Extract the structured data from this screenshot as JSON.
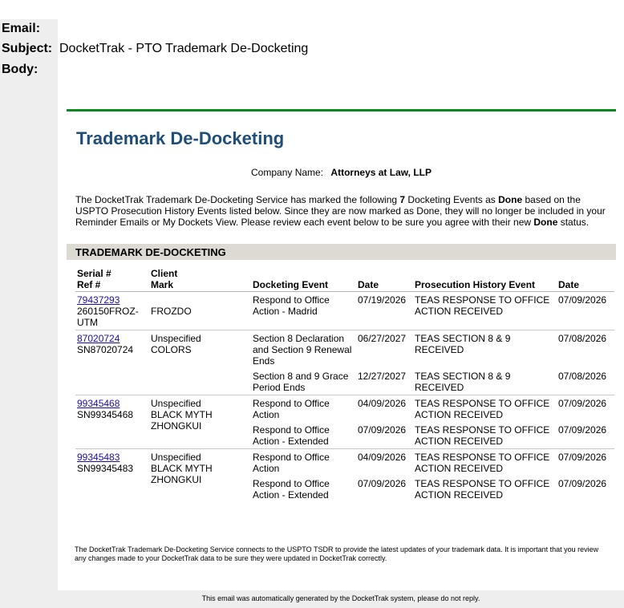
{
  "headers": {
    "email_label": "Email:",
    "subject_label": "Subject:",
    "subject_value": "DocketTrak - PTO Trademark De-Docketing",
    "body_label": "Body:"
  },
  "content": {
    "title": "Trademark De-Docketing",
    "company_label": "Company Name:",
    "company_value": "Attorneys at Law, LLP",
    "intro_part1": "The DocketTrak Trademark De-Docketing Service has marked the following ",
    "intro_count": "7",
    "intro_part2": " Docketing Events as ",
    "intro_done1": "Done",
    "intro_part3": " based on the USPTO Prosecution History Events listed below. Since they are now marked as Done, they will no longer be included in your Reminder Emails or My Dockets View. Please review each event below to be sure you agree with their new ",
    "intro_done2": "Done",
    "intro_part4": " status.",
    "section_title": "TRADEMARK DE-DOCKETING"
  },
  "table": {
    "headers": {
      "serial": "Serial #",
      "ref": "Ref #",
      "client": "Client",
      "mark": "Mark",
      "event": "Docketing Event",
      "date": "Date",
      "phe": "Prosecution History Event",
      "date2": "Date"
    },
    "groups": [
      {
        "serial": "79437293",
        "ref": "260150FROZ-UTM",
        "client": "",
        "mark": "FROZDO",
        "events": [
          {
            "event": "Respond to Office Action - Madrid",
            "date": "07/19/2026",
            "phe": "TEAS RESPONSE TO OFFICE ACTION RECEIVED",
            "phe_date": "07/09/2026"
          }
        ]
      },
      {
        "serial": "87020724",
        "ref": "SN87020724",
        "client": "Unspecified",
        "mark": "COLORS",
        "events": [
          {
            "event": "Section 8 Declaration and Section 9 Renewal Ends",
            "date": "06/27/2027",
            "phe": "TEAS SECTION 8 & 9 RECEIVED",
            "phe_date": "07/08/2026"
          },
          {
            "event": "Section 8 and 9 Grace Period Ends",
            "date": "12/27/2027",
            "phe": "TEAS SECTION 8 & 9 RECEIVED",
            "phe_date": "07/08/2026"
          }
        ]
      },
      {
        "serial": "99345468",
        "ref": "SN99345468",
        "client": "Unspecified",
        "mark": "BLACK MYTH ZHONGKUI",
        "events": [
          {
            "event": "Respond to Office Action",
            "date": "04/09/2026",
            "phe": "TEAS RESPONSE TO OFFICE ACTION RECEIVED",
            "phe_date": "07/09/2026"
          },
          {
            "event": "Respond to Office Action - Extended",
            "date": "07/09/2026",
            "phe": "TEAS RESPONSE TO OFFICE ACTION RECEIVED",
            "phe_date": "07/09/2026"
          }
        ]
      },
      {
        "serial": "99345483",
        "ref": "SN99345483",
        "client": "Unspecified",
        "mark": "BLACK MYTH ZHONGKUI",
        "events": [
          {
            "event": "Respond to Office Action",
            "date": "04/09/2026",
            "phe": "TEAS RESPONSE TO OFFICE ACTION RECEIVED",
            "phe_date": "07/09/2026"
          },
          {
            "event": "Respond to Office Action - Extended",
            "date": "07/09/2026",
            "phe": "TEAS RESPONSE TO OFFICE ACTION RECEIVED",
            "phe_date": "07/09/2026"
          }
        ]
      }
    ]
  },
  "footer": {
    "note": "The DocketTrak Trademark De-Docketing Service connects to the USPTO TSDR to provide the latest updates of your trademark data. It is important that you review any changes made to your DocketTrak data to be sure they were updated in DocketTrak correctly.",
    "auto": "This email was automatically generated by the DocketTrak system, please do not reply."
  },
  "colors": {
    "accent_green": "#0a8a1f",
    "title_blue": "#1f4e79",
    "link_blue": "#1a0dab",
    "section_bar": "#dcdad2",
    "gutter_gray": "#eeeeee"
  }
}
